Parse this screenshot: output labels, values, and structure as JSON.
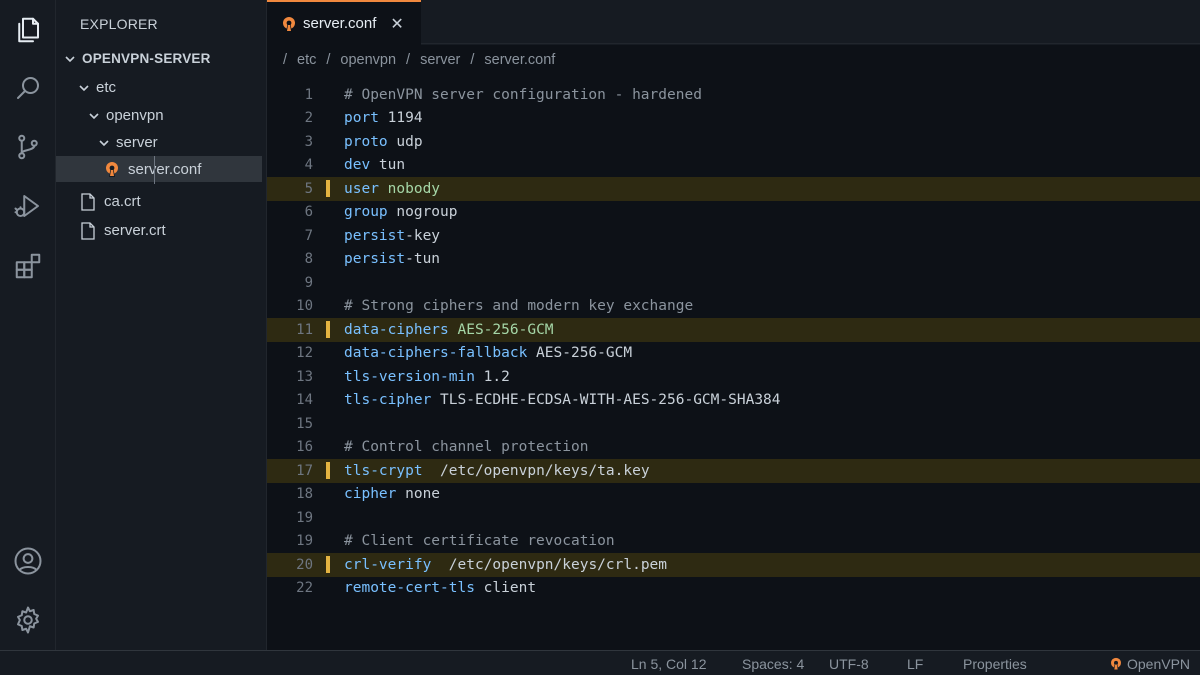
{
  "activity_bar": {
    "icons": [
      "explorer-icon",
      "search-icon",
      "source-control-icon",
      "run-debug-icon",
      "extensions-icon",
      "account-icon",
      "settings-gear-icon"
    ]
  },
  "sidebar": {
    "title": "EXPLORER",
    "project": "OPENVPN-SERVER",
    "tree": [
      {
        "label": "etc",
        "type": "folder"
      },
      {
        "label": "openvpn",
        "type": "folder"
      },
      {
        "label": "server",
        "type": "folder"
      },
      {
        "label": "server.conf",
        "type": "file",
        "selected": true
      },
      {
        "label": "ca.crt",
        "type": "file"
      },
      {
        "label": "server.crt",
        "type": "file"
      }
    ]
  },
  "tab": {
    "label": "server.conf",
    "close": "✕"
  },
  "breadcrumb": {
    "items": [
      "etc",
      "openvpn",
      "server",
      "server.conf"
    ],
    "separator": "/"
  },
  "editor": {
    "lines": [
      {
        "n": "1",
        "comment": "# OpenVPN server configuration - hardened"
      },
      {
        "n": "2",
        "key": "port",
        "value": " 1194"
      },
      {
        "n": "3",
        "key": "proto",
        "value": " udp"
      },
      {
        "n": "4",
        "key": "dev",
        "value": " tun"
      },
      {
        "n": "5",
        "key": "user",
        "value": " nobody",
        "highlight": true
      },
      {
        "n": "6",
        "key": "group",
        "value": " nogroup"
      },
      {
        "n": "7",
        "key": "persist",
        "value": "-key"
      },
      {
        "n": "8",
        "key": "persist",
        "value": "-tun"
      },
      {
        "n": "9"
      },
      {
        "n": "10",
        "comment": "# Strong ciphers and modern key exchange"
      },
      {
        "n": "11",
        "key": "data-ciphers",
        "value": " AES-256-GCM",
        "highlight": true
      },
      {
        "n": "12",
        "key": "data-ciphers-fallback",
        "value": " AES-256-GCM"
      },
      {
        "n": "13",
        "key": "tls-version-min",
        "value": " 1.2"
      },
      {
        "n": "14",
        "key": "tls-cipher",
        "value": " TLS-ECDHE-ECDSA-WITH-AES-256-GCM-SHA384"
      },
      {
        "n": "15"
      },
      {
        "n": "16",
        "comment": "# Control channel protection"
      },
      {
        "n": "17",
        "key": "tls-crypt",
        "value": "  /etc/openvpn/keys/ta.key",
        "highlight": true
      },
      {
        "n": "18",
        "key": "cipher",
        "value": " none"
      },
      {
        "n": "19"
      },
      {
        "n": "19",
        "comment": "# Client certificate revocation"
      },
      {
        "n": "20",
        "key": "crl-verify",
        "value": "  /etc/openvpn/keys/crl.pem",
        "highlight": true
      },
      {
        "n": "22",
        "key": "remote-cert-tls",
        "value": " client"
      }
    ]
  },
  "status_bar": {
    "position": "Ln 5, Col 12",
    "spaces": "Spaces: 4",
    "encoding": "UTF-8",
    "eol": "LF",
    "language": "Properties",
    "brand": "OpenVPN"
  },
  "colors": {
    "accent": "#f0883e",
    "highlight_marker": "#e3b341",
    "keyword": "#79c0ff",
    "comment": "#8b949e"
  }
}
